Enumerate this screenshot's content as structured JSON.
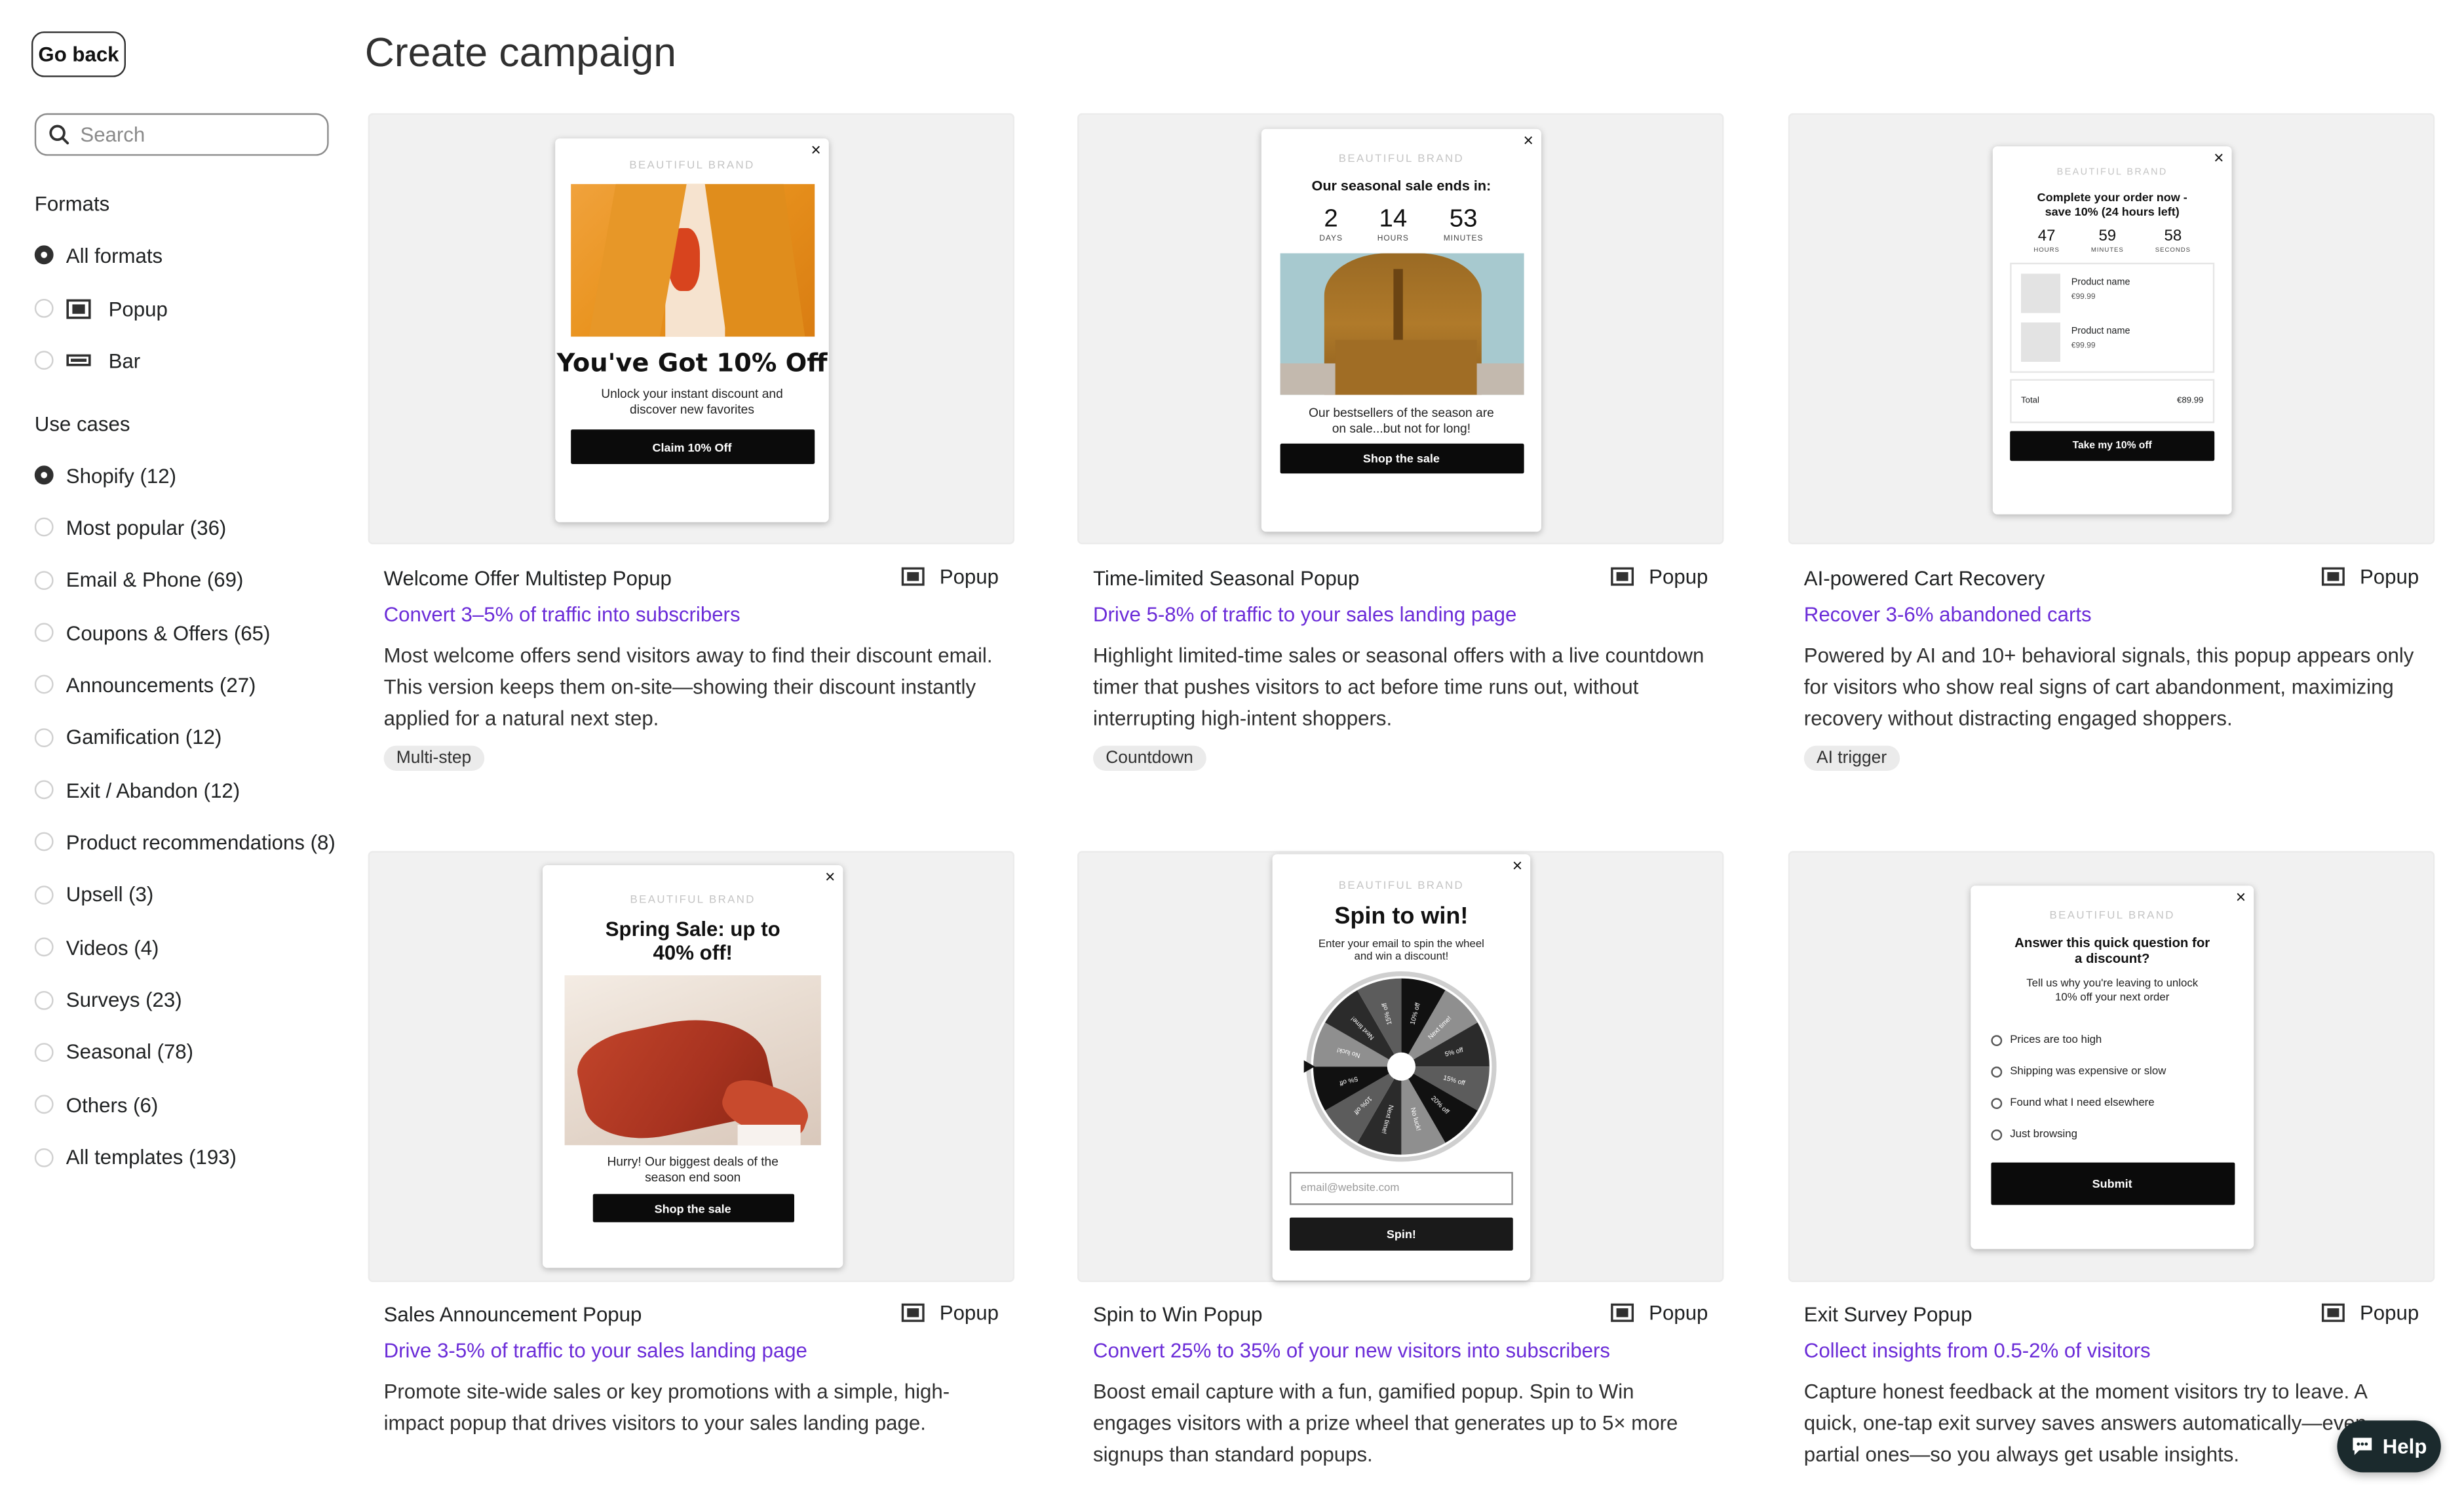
{
  "app": {
    "back_label": "Go back",
    "page_title": "Create campaign",
    "help_label": "Help"
  },
  "sidebar": {
    "search_placeholder": "Search",
    "formats_title": "Formats",
    "formats": [
      {
        "label": "All formats",
        "selected": true,
        "icon": ""
      },
      {
        "label": "Popup",
        "selected": false,
        "icon": "popup-format-icon"
      },
      {
        "label": "Bar",
        "selected": false,
        "icon": "bar-format-icon"
      }
    ],
    "usecases_title": "Use cases",
    "usecases": [
      {
        "label": "Shopify (12)",
        "selected": true
      },
      {
        "label": "Most popular (36)",
        "selected": false
      },
      {
        "label": "Email & Phone (69)",
        "selected": false
      },
      {
        "label": "Coupons & Offers (65)",
        "selected": false
      },
      {
        "label": "Announcements (27)",
        "selected": false
      },
      {
        "label": "Gamification (12)",
        "selected": false
      },
      {
        "label": "Exit / Abandon (12)",
        "selected": false
      },
      {
        "label": "Product recommendations (8)",
        "selected": false
      },
      {
        "label": "Upsell (3)",
        "selected": false
      },
      {
        "label": "Videos (4)",
        "selected": false
      },
      {
        "label": "Surveys (23)",
        "selected": false
      },
      {
        "label": "Seasonal (78)",
        "selected": false
      },
      {
        "label": "Others (6)",
        "selected": false
      },
      {
        "label": "All templates (193)",
        "selected": false
      }
    ]
  },
  "cards": [
    {
      "title": "Welcome Offer Multistep Popup",
      "format": "Popup",
      "subtitle": "Convert 3–5% of traffic into subscribers",
      "description": "Most welcome offers send visitors away to find their discount email. This version keeps them on-site—showing their discount instantly applied for a natural next step.",
      "tag": "Multi-step",
      "preview": {
        "brand": "BEAUTIFUL BRAND",
        "headline": "You've Got 10% Off",
        "body": "Unlock your instant discount and discover new favorites",
        "button": "Claim 10% Off",
        "close": "×"
      }
    },
    {
      "title": "Time-limited Seasonal Popup",
      "format": "Popup",
      "subtitle": "Drive 5-8% of traffic to your sales landing page",
      "description": "Highlight limited-time sales or seasonal offers with a live countdown timer that pushes visitors to act before time runs out, without interrupting high-intent shoppers.",
      "tag": "Countdown",
      "preview": {
        "brand": "BEAUTIFUL BRAND",
        "headline": "Our seasonal sale ends in:",
        "countdown": [
          {
            "value": "2",
            "unit": "DAYS"
          },
          {
            "value": "14",
            "unit": "HOURS"
          },
          {
            "value": "53",
            "unit": "MINUTES"
          }
        ],
        "body": "Our bestsellers of the season are on sale...but not for long!",
        "button": "Shop the sale",
        "close": "×"
      }
    },
    {
      "title": "AI-powered Cart Recovery",
      "format": "Popup",
      "subtitle": "Recover 3-6% abandoned carts",
      "description": "Powered by AI and 10+ behavioral signals, this popup appears only for visitors who show real signs of cart abandonment, maximizing recovery without distracting engaged shoppers.",
      "tag": "AI trigger",
      "preview": {
        "brand": "BEAUTIFUL BRAND",
        "headline": "Complete your order now - save 10% (24 hours left)",
        "countdown": [
          {
            "value": "47",
            "unit": "HOURS"
          },
          {
            "value": "59",
            "unit": "MINUTES"
          },
          {
            "value": "58",
            "unit": "SECONDS"
          }
        ],
        "products": [
          {
            "name": "Product name",
            "price": "€99.99"
          },
          {
            "name": "Product name",
            "price": "€99.99"
          }
        ],
        "total_label": "Total",
        "total_value": "€89.99",
        "button": "Take my 10% off",
        "close": "×"
      }
    },
    {
      "title": "Sales Announcement Popup",
      "format": "Popup",
      "subtitle": "Drive 3-5% of traffic to your sales landing page",
      "description": "Promote site-wide sales or key promotions with a simple, high-impact popup that drives visitors to your sales landing page.",
      "preview": {
        "brand": "BEAUTIFUL BRAND",
        "headline": "Spring Sale: up to 40% off!",
        "body": "Hurry! Our biggest deals of the season end soon",
        "button": "Shop the sale",
        "close": "×"
      }
    },
    {
      "title": "Spin to Win Popup",
      "format": "Popup",
      "subtitle": "Convert 25% to 35% of your new visitors into subscribers",
      "description": "Boost email capture with a fun, gamified popup. Spin to Win engages visitors with a prize wheel that generates up to 5× more signups than standard popups.",
      "preview": {
        "brand": "BEAUTIFUL BRAND",
        "headline": "Spin to win!",
        "body": "Enter your email to spin the wheel and win a discount!",
        "input_placeholder": "email@website.com",
        "button": "Spin!",
        "close": "×",
        "wheel_labels": [
          "10% off",
          "Next time!",
          "5% off",
          "15% off",
          "20% off",
          "No luck!",
          "Next time!",
          "10% off",
          "5% off",
          "No luck!",
          "Next time!",
          "15% off"
        ]
      }
    },
    {
      "title": "Exit Survey Popup",
      "format": "Popup",
      "subtitle": "Collect insights from 0.5-2% of visitors",
      "description": "Capture honest feedback at the moment visitors try to leave. A quick, one-tap exit survey saves answers automatically—even partial ones—so you always get usable insights.",
      "preview": {
        "brand": "BEAUTIFUL BRAND",
        "headline": "Answer this quick question for a discount?",
        "body": "Tell us why you're leaving to unlock 10% off your next order",
        "options": [
          "Prices are too high",
          "Shipping was expensive or slow",
          "Found what I need elsewhere",
          "Just browsing"
        ],
        "button": "Submit",
        "close": "×"
      }
    }
  ]
}
